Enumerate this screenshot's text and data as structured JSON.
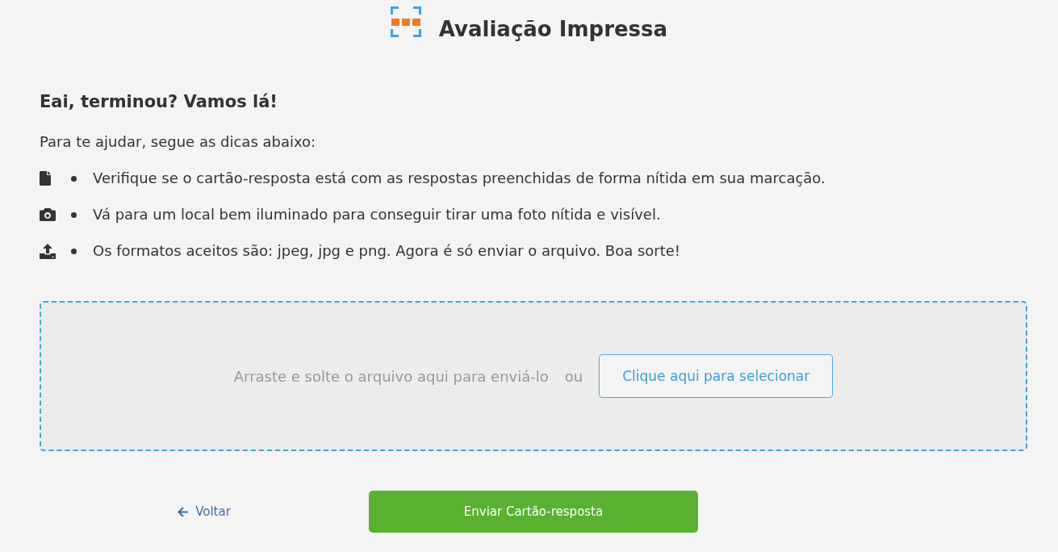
{
  "header": {
    "title": "Avaliação Impressa"
  },
  "intro": {
    "heading": "Eai, terminou? Vamos lá!",
    "lead": "Para te ajudar, segue as dicas abaixo:"
  },
  "tips": [
    {
      "kind": "document",
      "text": "Verifique se o cartão-resposta está com as respostas preenchidas de forma nítida em sua marcação."
    },
    {
      "kind": "camera",
      "text": "Vá para um local bem iluminado para conseguir tirar uma foto nítida e visível."
    },
    {
      "kind": "upload",
      "text": "Os formatos aceitos são: jpeg, jpg e png. Agora é só enviar o arquivo. Boa sorte!"
    }
  ],
  "dropzone": {
    "hint": "Arraste e solte o arquivo aqui para enviá-lo",
    "separator": "ou",
    "button": "Clique aqui para selecionar"
  },
  "actions": {
    "back": "Voltar",
    "submit": "Enviar Cartão-resposta"
  }
}
